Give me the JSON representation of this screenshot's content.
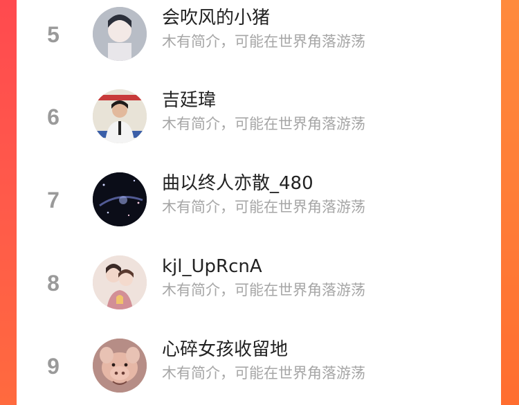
{
  "list": {
    "items": [
      {
        "rank": "5",
        "name": "会吹风的小猪",
        "bio": "木有简介，可能在世界角落游荡",
        "avatar": "avatar-anime-boy"
      },
      {
        "rank": "6",
        "name": "吉廷瑋",
        "bio": "木有简介，可能在世界角落游荡",
        "avatar": "avatar-photo-person"
      },
      {
        "rank": "7",
        "name": "曲以终人亦散_480",
        "bio": "木有简介，可能在世界角落游荡",
        "avatar": "avatar-night-scene"
      },
      {
        "rank": "8",
        "name": "kjl_UpRcnA",
        "bio": "木有简介，可能在世界角落游荡",
        "avatar": "avatar-illustrated-couple"
      },
      {
        "rank": "9",
        "name": "心碎女孩收留地",
        "bio": "木有简介，可能在世界角落游荡",
        "avatar": "avatar-pig"
      }
    ]
  },
  "colors": {
    "background_gradient_top": "#ff4a4f",
    "background_gradient_bottom": "#ff6a3e",
    "card": "#ffffff",
    "rank_text": "#9a9a9a",
    "name_text": "#222222",
    "bio_text": "#a6a6a6"
  }
}
